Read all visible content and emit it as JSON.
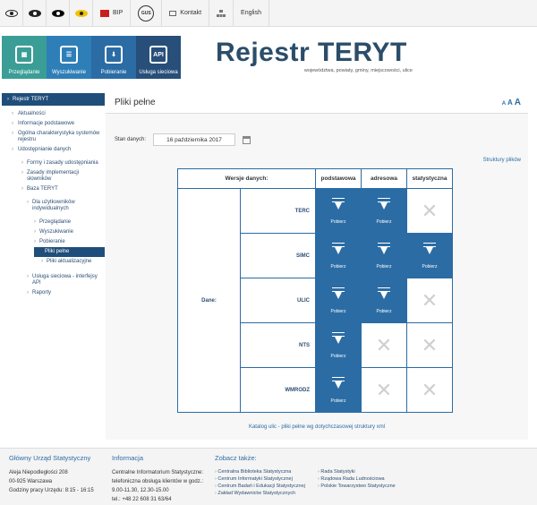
{
  "topbar": {
    "bip_label": "BIP",
    "gus_label": "GUS",
    "kontakt_label": "Kontakt",
    "language_label": "English"
  },
  "header": {
    "tiles": [
      {
        "label": "Przeglądanie",
        "icon": "grid-icon"
      },
      {
        "label": "Wyszukiwanie",
        "icon": "search-doc-icon"
      },
      {
        "label": "Pobieranie",
        "icon": "download-icon"
      },
      {
        "label": "Usługa sieciowa",
        "icon": "api-icon",
        "icon_text": "API"
      }
    ],
    "title": "Rejestr TERYT",
    "subtitle": "województwa, powiaty, gminy, miejscowości, ulice"
  },
  "nav": {
    "heading": "Rejestr TERYT",
    "items": [
      {
        "label": "Aktualności"
      },
      {
        "label": "Informacje podstawowe"
      },
      {
        "label": "Ogólna charakterystyka systemów rejestru"
      },
      {
        "label": "Udostępnianie danych"
      },
      {
        "label": "Formy i zasady udostępniania"
      },
      {
        "label": "Zasady implementacji słowników"
      },
      {
        "label": "Baza TERYT"
      },
      {
        "label": "Dla użytkowników indywidualnych"
      },
      {
        "label": "Przeglądanie"
      },
      {
        "label": "Wyszukiwanie"
      },
      {
        "label": "Pobieranie"
      },
      {
        "label": "Pliki pełne"
      },
      {
        "label": "Pliki aktualizacyjne"
      },
      {
        "label": "Usługa sieciowa - interfejsy API"
      },
      {
        "label": "Raporty"
      }
    ]
  },
  "main": {
    "title": "Pliki pełne",
    "font_sizes": [
      "A",
      "A",
      "A"
    ],
    "stan_label": "Stan danych:",
    "date_value": "16 października 2017",
    "struktury_link": "Struktury plików",
    "table": {
      "versions_header": "Wersje danych:",
      "columns": [
        "podstawowa",
        "adresowa",
        "statystyczna"
      ],
      "dane_label": "Dane:",
      "download_label": "Pobierz",
      "rows": [
        {
          "name": "TERC",
          "cells": [
            true,
            true,
            false
          ]
        },
        {
          "name": "SIMC",
          "cells": [
            true,
            true,
            true
          ]
        },
        {
          "name": "ULIC",
          "cells": [
            true,
            true,
            false
          ]
        },
        {
          "name": "NTS",
          "cells": [
            true,
            false,
            false
          ]
        },
        {
          "name": "WMRODZ",
          "cells": [
            true,
            false,
            false
          ]
        }
      ]
    },
    "katalog_link": "Katalog ulic - pliki pełne wg dotychczasowej struktury xml"
  },
  "footer": {
    "col1": {
      "heading": "Główny Urząd Statystyczny",
      "lines": [
        "Aleja Niepodległości 208",
        "00-925 Warszawa",
        "",
        "Godziny pracy Urzędu: 8:15 - 16:15"
      ]
    },
    "col2": {
      "heading": "Informacja",
      "lines": [
        "Centralne Informatorium Statystyczne:",
        "",
        "telefoniczna obsługa klientów w godz.:",
        "9.00-11.30, 12.30-15.00",
        "tel.: +48 22 608 31 63/64"
      ]
    },
    "col3": {
      "heading": "Zobacz także:",
      "links": [
        "Centralna Biblioteka Statystyczna",
        "Centrum Informatyki Statystycznej",
        "Centrum Badań i Edukacji Statystycznej",
        "Zakład Wydawnictw Statystycznych"
      ]
    },
    "col4": {
      "links": [
        "Rada Statystyki",
        "Rządowa Rada Ludnościowa",
        "Polskie Towarzystwo Statystyczne"
      ]
    }
  }
}
